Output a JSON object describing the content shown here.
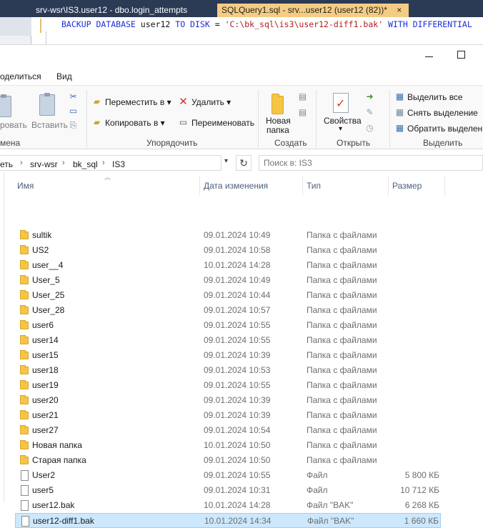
{
  "ssms": {
    "tabs": [
      {
        "label": "srv-wsr\\IS3.user12 - dbo.login_attempts",
        "active": false
      },
      {
        "label": "SQLQuery1.sql - srv...user12 (user12 (82))*",
        "active": true
      }
    ],
    "tab_close": "×",
    "sql": {
      "kw1": "BACKUP DATABASE",
      "db": "user12",
      "kw2": "TO DISK",
      "eq": "=",
      "path": "'C:\\bk_sql\\is3\\user12-diff1.bak'",
      "kw3": "WITH DIFFERENTIAL"
    }
  },
  "menu": {
    "share": "оделиться",
    "view": "Вид"
  },
  "ribbon": {
    "paste_cut": "ровать",
    "paste": "Вставить",
    "clipboard_label": "мена",
    "move_to": "Переместить в",
    "copy_to": "Копировать в",
    "delete": "Удалить",
    "rename": "Переименовать",
    "organize_label": "Упорядочить",
    "new_folder_line1": "Новая",
    "new_folder_line2": "папка",
    "create_label": "Создать",
    "properties": "Свойства",
    "open_label": "Открыть",
    "select_all": "Выделить все",
    "select_none": "Снять выделение",
    "invert_selection": "Обратить выделени",
    "select_label": "Выделить",
    "dropdown_glyph": "▾"
  },
  "address": {
    "crumbs": [
      "еть",
      "srv-wsr",
      "bk_sql",
      "IS3"
    ],
    "separator": "›",
    "search_placeholder": "Поиск в: IS3"
  },
  "columns": {
    "name": "Имя",
    "date": "Дата изменения",
    "type": "Тип",
    "size": "Размер"
  },
  "files": [
    {
      "name": "sultik",
      "date": "09.01.2024 10:49",
      "type": "Папка с файлами",
      "size": "",
      "kind": "folder"
    },
    {
      "name": "US2",
      "date": "09.01.2024 10:58",
      "type": "Папка с файлами",
      "size": "",
      "kind": "folder"
    },
    {
      "name": "user__4",
      "date": "10.01.2024 14:28",
      "type": "Папка с файлами",
      "size": "",
      "kind": "folder"
    },
    {
      "name": "User_5",
      "date": "09.01.2024 10:49",
      "type": "Папка с файлами",
      "size": "",
      "kind": "folder"
    },
    {
      "name": "User_25",
      "date": "09.01.2024 10:44",
      "type": "Папка с файлами",
      "size": "",
      "kind": "folder"
    },
    {
      "name": "User_28",
      "date": "09.01.2024 10:57",
      "type": "Папка с файлами",
      "size": "",
      "kind": "folder"
    },
    {
      "name": "user6",
      "date": "09.01.2024 10:55",
      "type": "Папка с файлами",
      "size": "",
      "kind": "folder"
    },
    {
      "name": "user14",
      "date": "09.01.2024 10:55",
      "type": "Папка с файлами",
      "size": "",
      "kind": "folder"
    },
    {
      "name": "user15",
      "date": "09.01.2024 10:39",
      "type": "Папка с файлами",
      "size": "",
      "kind": "folder"
    },
    {
      "name": "user18",
      "date": "09.01.2024 10:53",
      "type": "Папка с файлами",
      "size": "",
      "kind": "folder"
    },
    {
      "name": "user19",
      "date": "09.01.2024 10:55",
      "type": "Папка с файлами",
      "size": "",
      "kind": "folder"
    },
    {
      "name": "user20",
      "date": "09.01.2024 10:39",
      "type": "Папка с файлами",
      "size": "",
      "kind": "folder"
    },
    {
      "name": "user21",
      "date": "09.01.2024 10:39",
      "type": "Папка с файлами",
      "size": "",
      "kind": "folder"
    },
    {
      "name": "user27",
      "date": "09.01.2024 10:54",
      "type": "Папка с файлами",
      "size": "",
      "kind": "folder"
    },
    {
      "name": "Новая папка",
      "date": "10.01.2024 10:50",
      "type": "Папка с файлами",
      "size": "",
      "kind": "folder"
    },
    {
      "name": "Старая папка",
      "date": "09.01.2024 10:50",
      "type": "Папка с файлами",
      "size": "",
      "kind": "folder"
    },
    {
      "name": "User2",
      "date": "09.01.2024 10:55",
      "type": "Файл",
      "size": "5 800 КБ",
      "kind": "file"
    },
    {
      "name": "user5",
      "date": "09.01.2024 10:31",
      "type": "Файл",
      "size": "10 712 КБ",
      "kind": "file"
    },
    {
      "name": "user12.bak",
      "date": "10.01.2024 14:28",
      "type": "Файл \"BAK\"",
      "size": "6 268 КБ",
      "kind": "file"
    },
    {
      "name": "user12-diff1.bak",
      "date": "10.01.2024 14:34",
      "type": "Файл \"BAK\"",
      "size": "1 660 КБ",
      "kind": "file",
      "selected": true
    }
  ],
  "colors": {
    "ssms_tab_bar": "#2b3a55",
    "ssms_active_tab": "#f5cc84",
    "sql_keyword": "#1b2edc",
    "sql_string": "#b01e1e",
    "selection_bg": "#cce8ff",
    "folder": "#f6c544"
  },
  "icons": {
    "folder": "folder-icon",
    "file": "file-icon",
    "delete": "delete-x-icon",
    "refresh": "refresh-icon"
  }
}
